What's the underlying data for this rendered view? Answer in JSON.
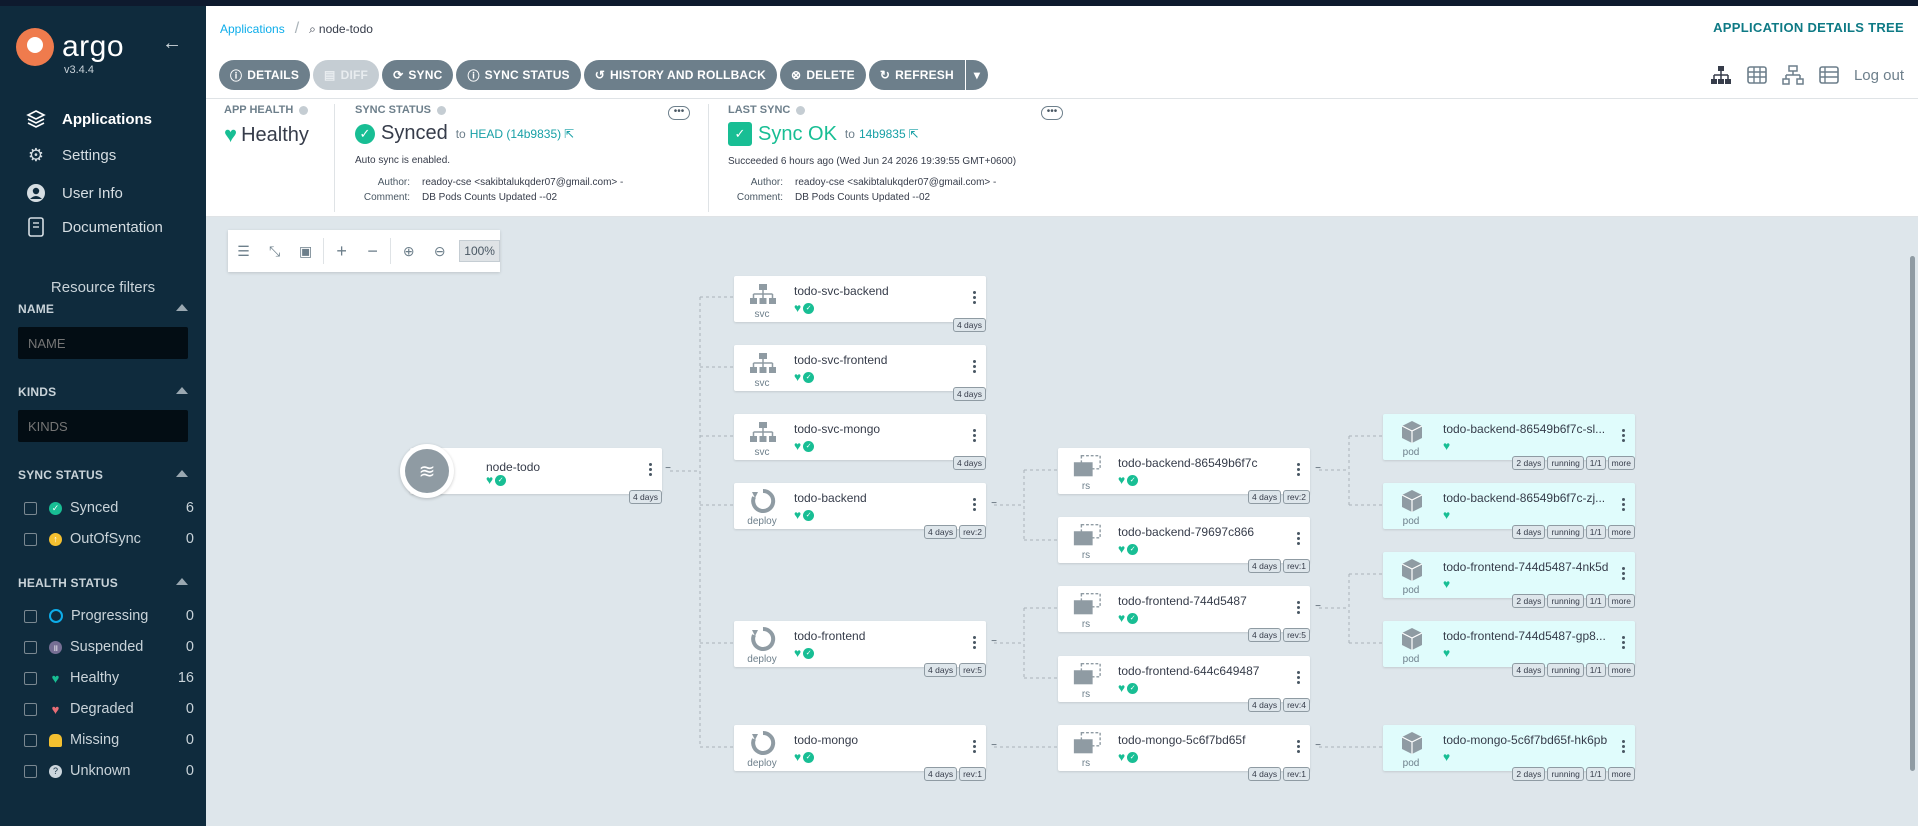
{
  "sidebar": {
    "brand": "argo",
    "version": "v3.4.4",
    "nav": [
      {
        "label": "Applications",
        "icon": "stack-icon"
      },
      {
        "label": "Settings",
        "icon": "gear-icon"
      },
      {
        "label": "User Info",
        "icon": "user-icon"
      },
      {
        "label": "Documentation",
        "icon": "book-icon"
      }
    ],
    "resource_filters": "Resource filters",
    "name_title": "NAME",
    "name_placeholder": "NAME",
    "kinds_title": "KINDS",
    "kinds_placeholder": "KINDS",
    "sync_status_title": "SYNC STATUS",
    "sync_status": [
      {
        "label": "Synced",
        "count": "6",
        "color": "#18be94"
      },
      {
        "label": "OutOfSync",
        "count": "0",
        "color": "#f4c030"
      }
    ],
    "health_status_title": "HEALTH STATUS",
    "health_status": [
      {
        "label": "Progressing",
        "count": "0",
        "color": "#0dadea"
      },
      {
        "label": "Suspended",
        "count": "0",
        "color": "#766f94"
      },
      {
        "label": "Healthy",
        "count": "16",
        "color": "#18be94"
      },
      {
        "label": "Degraded",
        "count": "0",
        "color": "#e96d76"
      },
      {
        "label": "Missing",
        "count": "0",
        "color": "#f4c030"
      },
      {
        "label": "Unknown",
        "count": "0",
        "color": "#ccd6dd"
      }
    ]
  },
  "header": {
    "breadcrumb_root": "Applications",
    "breadcrumb_current": "node-todo",
    "view_title": "APPLICATION DETAILS TREE",
    "toolbar": [
      "DETAILS",
      "DIFF",
      "SYNC",
      "SYNC STATUS",
      "HISTORY AND ROLLBACK",
      "DELETE",
      "REFRESH"
    ],
    "logout": "Log out"
  },
  "app_health": {
    "title": "APP HEALTH",
    "value": "Healthy"
  },
  "sync_status": {
    "title": "SYNC STATUS",
    "value": "Synced",
    "to": "to",
    "revision": "HEAD (14b9835)",
    "auto_sync": "Auto sync is enabled.",
    "author_label": "Author:",
    "author": "readoy-cse <sakibtalukqder07@gmail.com> -",
    "comment_label": "Comment:",
    "comment": "DB Pods Counts Updated --02"
  },
  "last_sync": {
    "title": "LAST SYNC",
    "value": "Sync OK",
    "to": "to",
    "revision": "14b9835",
    "succeeded": "Succeeded 6 hours ago (Wed Jun 24 2026 19:39:55 GMT+0600)",
    "author_label": "Author:",
    "author": "readoy-cse <sakibtalukqder07@gmail.com> -",
    "comment_label": "Comment:",
    "comment": "DB Pods Counts Updated --02"
  },
  "graph": {
    "zoom": "100%",
    "app": {
      "name": "node-todo",
      "age": "4 days"
    },
    "nodes": [
      {
        "name": "todo-svc-backend",
        "kind": "svc",
        "tags": [
          "4 days"
        ]
      },
      {
        "name": "todo-svc-frontend",
        "kind": "svc",
        "tags": [
          "4 days"
        ]
      },
      {
        "name": "todo-svc-mongo",
        "kind": "svc",
        "tags": [
          "4 days"
        ]
      },
      {
        "name": "todo-backend",
        "kind": "deploy",
        "tags": [
          "4 days",
          "rev:2"
        ]
      },
      {
        "name": "todo-frontend",
        "kind": "deploy",
        "tags": [
          "4 days",
          "rev:5"
        ]
      },
      {
        "name": "todo-mongo",
        "kind": "deploy",
        "tags": [
          "4 days",
          "rev:1"
        ]
      },
      {
        "name": "todo-backend-86549b6f7c",
        "kind": "rs",
        "tags": [
          "4 days",
          "rev:2"
        ]
      },
      {
        "name": "todo-backend-79697c866",
        "kind": "rs",
        "tags": [
          "4 days",
          "rev:1"
        ]
      },
      {
        "name": "todo-frontend-744d5487",
        "kind": "rs",
        "tags": [
          "4 days",
          "rev:5"
        ]
      },
      {
        "name": "todo-frontend-644c649487",
        "kind": "rs",
        "tags": [
          "4 days",
          "rev:4"
        ]
      },
      {
        "name": "todo-mongo-5c6f7bd65f",
        "kind": "rs",
        "tags": [
          "4 days",
          "rev:1"
        ]
      },
      {
        "name": "todo-backend-86549b6f7c-sl...",
        "kind": "pod",
        "tags": [
          "2 days",
          "running",
          "1/1",
          "more"
        ]
      },
      {
        "name": "todo-backend-86549b6f7c-zj...",
        "kind": "pod",
        "tags": [
          "4 days",
          "running",
          "1/1",
          "more"
        ]
      },
      {
        "name": "todo-frontend-744d5487-4nk5d",
        "kind": "pod",
        "tags": [
          "2 days",
          "running",
          "1/1",
          "more"
        ]
      },
      {
        "name": "todo-frontend-744d5487-gp8...",
        "kind": "pod",
        "tags": [
          "4 days",
          "running",
          "1/1",
          "more"
        ]
      },
      {
        "name": "todo-mongo-5c6f7bd65f-hk6pb",
        "kind": "pod",
        "tags": [
          "2 days",
          "running",
          "1/1",
          "more"
        ]
      }
    ]
  }
}
